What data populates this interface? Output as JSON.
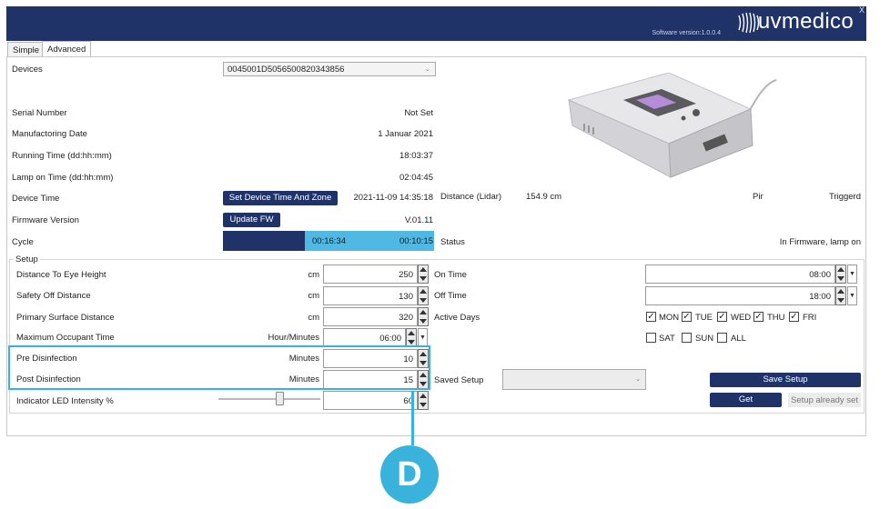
{
  "header": {
    "software_version": "Software version:1.0.0.4",
    "brand": "uvmedico",
    "close_label": "X"
  },
  "tabs": [
    {
      "label": "Simple",
      "active": false
    },
    {
      "label": "Advanced",
      "active": true
    }
  ],
  "device": {
    "devices_label": "Devices",
    "devices_value": "0045001D505650082034385​6",
    "serial_label": "Serial Number",
    "serial_value": "Not Set",
    "manufacturing_label": "Manufactoring Date",
    "manufacturing_value": "1 Januar 2021",
    "running_label": "Running Time (dd:hh:mm)",
    "running_value": "18:03:37",
    "lamp_label": "Lamp on Time (dd:hh:mm)",
    "lamp_value": "02:04:45",
    "device_time_label": "Device Time",
    "set_time_button": "Set Device Time And Zone",
    "device_time_value": "2021-11-09 14:35:18",
    "firmware_label": "Firmware Version",
    "update_fw_button": "Update FW",
    "firmware_value": "V.01.11",
    "cycle_label": "Cycle",
    "cycle_elapsed": "00:16:34",
    "cycle_remaining": "00:10:15",
    "cycle_progress": 0.39
  },
  "sensors": {
    "distance_label": "Distance (Lidar)",
    "distance_value": "154.9 cm",
    "pir_label": "Pir",
    "pir_value": "Triggerd",
    "status_label": "Status",
    "status_value": "In Firmware, lamp on"
  },
  "setup": {
    "legend": "Setup",
    "rows": [
      {
        "label": "Distance To Eye Height",
        "unit": "cm",
        "value": "250"
      },
      {
        "label": "Safety Off Distance",
        "unit": "cm",
        "value": "130"
      },
      {
        "label": "Primary Surface Distance",
        "unit": "cm",
        "value": "320"
      },
      {
        "label": "Maximum Occupant Time",
        "unit": "Hour/Minutes",
        "value": "06:00"
      },
      {
        "label": "Pre Disinfection",
        "unit": "Minutes",
        "value": "10"
      },
      {
        "label": "Post Disinfection",
        "unit": "Minutes",
        "value": "15"
      },
      {
        "label": "Indicator LED Intensity %",
        "unit": "",
        "value": "60"
      }
    ],
    "led_intensity_level": 0.6,
    "on_time_label": "On Time",
    "on_time_value": "08:00",
    "off_time_label": "Off Time",
    "off_time_value": "18:00",
    "active_days_label": "Active Days",
    "days": [
      {
        "label": "MON",
        "checked": true
      },
      {
        "label": "TUE",
        "checked": true
      },
      {
        "label": "WED",
        "checked": true
      },
      {
        "label": "THU",
        "checked": true
      },
      {
        "label": "FRI",
        "checked": true
      },
      {
        "label": "SAT",
        "checked": false
      },
      {
        "label": "SUN",
        "checked": false
      },
      {
        "label": "ALL",
        "checked": false
      }
    ],
    "saved_setup_label": "Saved Setup",
    "saved_setup_value": "",
    "save_button": "Save Setup",
    "get_button": "Get",
    "already_set_label": "Setup already set"
  },
  "callout": {
    "letter": "D",
    "color": "#3ab3dc"
  },
  "colors": {
    "navy": "#1f3369",
    "accent": "#4fb9e3"
  }
}
